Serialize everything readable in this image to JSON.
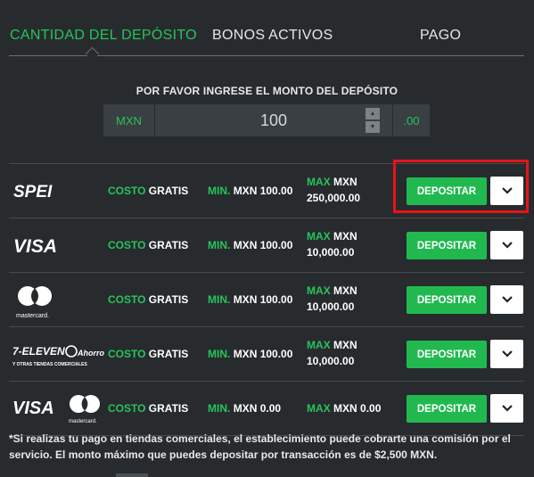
{
  "tabs": [
    {
      "label": "CANTIDAD DEL DEPÓSITO",
      "active": true
    },
    {
      "label": "BONOS ACTIVOS",
      "active": false
    },
    {
      "label": "PAGO",
      "active": false
    }
  ],
  "amount": {
    "label": "POR FAVOR INGRESE EL MONTO DEL DEPÓSITO",
    "currency": "MXN",
    "value": "100",
    "decimals": ".00"
  },
  "methods": [
    {
      "logo_text": "SPEI",
      "cost_label": "COSTO",
      "cost_value": "GRATIS",
      "min_label": "MIN.",
      "min_value": "MXN 100.00",
      "max_label": "MAX",
      "max_value_line1": "MXN",
      "max_value_line2": "250,000.00",
      "button": "DEPOSITAR"
    },
    {
      "logo_text": "VISA",
      "cost_label": "COSTO",
      "cost_value": "GRATIS",
      "min_label": "MIN.",
      "min_value": "MXN 100.00",
      "max_label": "MAX",
      "max_value_line1": "MXN",
      "max_value_line2": "10,000.00",
      "button": "DEPOSITAR"
    },
    {
      "logo_text": "mastercard.",
      "cost_label": "COSTO",
      "cost_value": "GRATIS",
      "min_label": "MIN.",
      "min_value": "MXN 100.00",
      "max_label": "MAX",
      "max_value_line1": "MXN",
      "max_value_line2": "10,000.00",
      "button": "DEPOSITAR"
    },
    {
      "logo_text": "7-ELEVEN",
      "logo_sub": "Y OTRAS TIENDAS COMERCIALES",
      "logo_partner": "Ahorro",
      "cost_label": "COSTO",
      "cost_value": "GRATIS",
      "min_label": "MIN.",
      "min_value": "MXN 100.00",
      "max_label": "MAX",
      "max_value_line1": "MXN",
      "max_value_line2": "10,000.00",
      "button": "DEPOSITAR"
    },
    {
      "logo_text": "VISA",
      "logo_text2": "mastercard.",
      "cost_label": "COSTO",
      "cost_value": "GRATIS",
      "min_label": "MIN.",
      "min_value": "MXN 0.00",
      "max_label": "MAX",
      "max_value_single": "MXN 0.00",
      "button": "DEPOSITAR"
    }
  ],
  "footnote": "*Si realizas tu pago en tiendas comerciales, el establecimiento puede cobrarte una comisión por el servicio. El monto máximo que puedes depositar por transacción es de $2,500 MXN.",
  "colors": {
    "background": "#272b2e",
    "accent_green": "#27c45a",
    "button_green": "#21b94f",
    "highlight_red": "#ea1218"
  }
}
